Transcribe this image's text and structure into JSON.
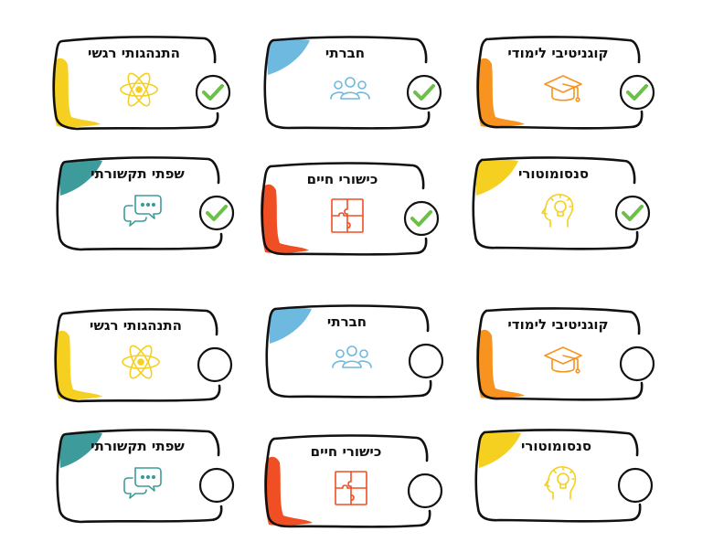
{
  "cards": [
    {
      "label": "קוגניטיבי לימודי",
      "icon": "graduation-cap-icon",
      "color": "#F7931E",
      "checked": true,
      "accent": "left-bar"
    },
    {
      "label": "חברתי",
      "icon": "people-group-icon",
      "color": "#6DB9E0",
      "checked": true,
      "accent": "top-left-blob"
    },
    {
      "label": "התנהגותי רגשי",
      "icon": "atom-icon",
      "color": "#F5D020",
      "checked": true,
      "accent": "left-bar"
    },
    {
      "label": "סנסומוטורי",
      "icon": "head-lightbulb-icon",
      "color": "#F5D020",
      "checked": true,
      "accent": "top-left-blob"
    },
    {
      "label": "כישורי חיים",
      "icon": "puzzle-icon",
      "color": "#F04E23",
      "checked": true,
      "accent": "left-bar"
    },
    {
      "label": "שפתי תקשורתי",
      "icon": "speech-bubbles-icon",
      "color": "#3E9B9B",
      "checked": true,
      "accent": "top-left-blob"
    },
    {
      "label": "קוגניטיבי לימודי",
      "icon": "graduation-cap-icon",
      "color": "#F7931E",
      "checked": false,
      "accent": "left-bar"
    },
    {
      "label": "חברתי",
      "icon": "people-group-icon",
      "color": "#6DB9E0",
      "checked": false,
      "accent": "top-left-blob"
    },
    {
      "label": "התנהגותי רגשי",
      "icon": "atom-icon",
      "color": "#F5D020",
      "checked": false,
      "accent": "left-bar"
    },
    {
      "label": "סנסומוטורי",
      "icon": "head-lightbulb-icon",
      "color": "#F5D020",
      "checked": false,
      "accent": "top-left-blob"
    },
    {
      "label": "כישורי חיים",
      "icon": "puzzle-icon",
      "color": "#F04E23",
      "checked": false,
      "accent": "left-bar"
    },
    {
      "label": "שפתי תקשורתי",
      "icon": "speech-bubbles-icon",
      "color": "#3E9B9B",
      "checked": false,
      "accent": "top-left-blob"
    }
  ],
  "check_color": "#6CC04A"
}
